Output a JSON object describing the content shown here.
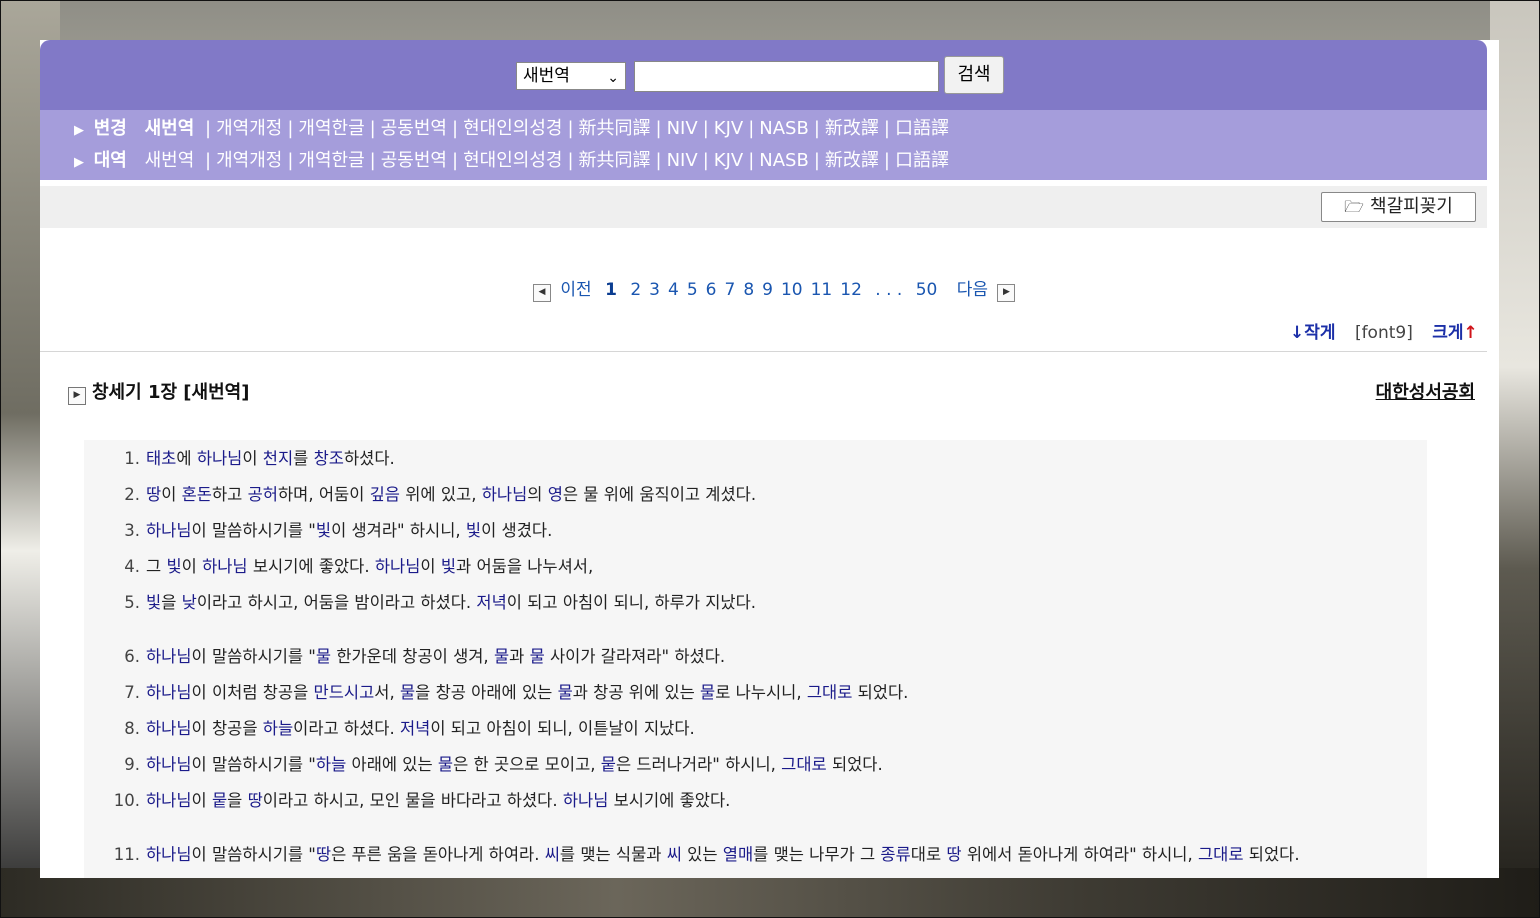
{
  "search": {
    "select_value": "새번역",
    "input_value": "",
    "button_label": "검색"
  },
  "versions": {
    "row1_label": "변경",
    "row1_selected": "새번역",
    "row2_label": "대역",
    "row2_first": "새번역",
    "options": [
      "개역개정",
      "개역한글",
      "공동번역",
      "현대인의성경",
      "新共同譯",
      "NIV",
      "KJV",
      "NASB",
      "新改譯",
      "口語譯"
    ]
  },
  "toolbar": {
    "bookmark_label": "책갈피꽂기"
  },
  "pager": {
    "prev_label": "이전",
    "current": "1",
    "pages": [
      "2",
      "3",
      "4",
      "5",
      "6",
      "7",
      "8",
      "9",
      "10",
      "11",
      "12"
    ],
    "ellipsis": ". . .",
    "last": "50",
    "next_label": "다음"
  },
  "font_control": {
    "smaller_label": "↓작게",
    "current": "[font9]",
    "larger_label": "크게",
    "larger_arrow": "↑"
  },
  "chapter": {
    "title": "창세기 1장 [새번역]",
    "publisher": "대한성서공회"
  },
  "verses": [
    {
      "num": "1.",
      "parts": [
        [
          "태초",
          "w"
        ],
        [
          "에 ",
          ""
        ],
        [
          "하나님",
          "w"
        ],
        [
          "이 ",
          ""
        ],
        [
          "천지",
          "w"
        ],
        [
          "를 ",
          ""
        ],
        [
          "창조",
          "w"
        ],
        [
          "하셨다.",
          ""
        ]
      ]
    },
    {
      "num": "2.",
      "parts": [
        [
          "땅",
          "w"
        ],
        [
          "이 ",
          ""
        ],
        [
          "혼돈",
          "w"
        ],
        [
          "하고 ",
          ""
        ],
        [
          "공허",
          "w"
        ],
        [
          "하며, 어둠이 ",
          ""
        ],
        [
          "깊음",
          "w"
        ],
        [
          " 위에 있고, ",
          ""
        ],
        [
          "하나님",
          "w"
        ],
        [
          "의 ",
          ""
        ],
        [
          "영",
          "w"
        ],
        [
          "은 물 위에 움직이고 계셨다.",
          ""
        ]
      ]
    },
    {
      "num": "3.",
      "parts": [
        [
          "하나님",
          "w"
        ],
        [
          "이 말씀하시기를 \"",
          ""
        ],
        [
          "빛",
          "w"
        ],
        [
          "이 생겨라\" 하시니, ",
          ""
        ],
        [
          "빛",
          "w"
        ],
        [
          "이 생겼다.",
          ""
        ]
      ]
    },
    {
      "num": "4.",
      "parts": [
        [
          "그 ",
          ""
        ],
        [
          "빛",
          "w"
        ],
        [
          "이 ",
          ""
        ],
        [
          "하나님",
          "w"
        ],
        [
          " 보시기에 좋았다. ",
          ""
        ],
        [
          "하나님",
          "w"
        ],
        [
          "이 ",
          ""
        ],
        [
          "빛",
          "w"
        ],
        [
          "과 어둠을 나누셔서,",
          ""
        ]
      ]
    },
    {
      "num": "5.",
      "parts": [
        [
          "빛",
          "w"
        ],
        [
          "을 ",
          ""
        ],
        [
          "낮",
          "w"
        ],
        [
          "이라고 하시고, 어둠을 밤이라고 하셨다. ",
          ""
        ],
        [
          "저녁",
          "w"
        ],
        [
          "이 되고 아침이 되니, 하루가 지났다.",
          ""
        ]
      ]
    },
    {
      "num": "6.",
      "parts": [
        [
          "하나님",
          "w"
        ],
        [
          "이 말씀하시기를 \"",
          ""
        ],
        [
          "물",
          "w"
        ],
        [
          " 한가운데 창공이 생겨, ",
          ""
        ],
        [
          "물",
          "w"
        ],
        [
          "과 ",
          ""
        ],
        [
          "물",
          "w"
        ],
        [
          " 사이가 갈라져라\" 하셨다.",
          ""
        ]
      ]
    },
    {
      "num": "7.",
      "parts": [
        [
          "하나님",
          "w"
        ],
        [
          "이 이처럼 창공을 ",
          ""
        ],
        [
          "만드시고",
          "w"
        ],
        [
          "서, ",
          ""
        ],
        [
          "물",
          "w"
        ],
        [
          "을 창공 아래에 있는 ",
          ""
        ],
        [
          "물",
          "w"
        ],
        [
          "과 창공 위에 있는 ",
          ""
        ],
        [
          "물",
          "w"
        ],
        [
          "로 나누시니, ",
          ""
        ],
        [
          "그대로",
          "w"
        ],
        [
          " 되었다.",
          ""
        ]
      ]
    },
    {
      "num": "8.",
      "parts": [
        [
          "하나님",
          "w"
        ],
        [
          "이 창공을 ",
          ""
        ],
        [
          "하늘",
          "w"
        ],
        [
          "이라고 하셨다. ",
          ""
        ],
        [
          "저녁",
          "w"
        ],
        [
          "이 되고 아침이 되니, 이튿날이 지났다.",
          ""
        ]
      ]
    },
    {
      "num": "9.",
      "parts": [
        [
          "하나님",
          "w"
        ],
        [
          "이 말씀하시기를 \"",
          ""
        ],
        [
          "하늘",
          "w"
        ],
        [
          " 아래에 있는 ",
          ""
        ],
        [
          "물",
          "w"
        ],
        [
          "은 한 곳으로 모이고, ",
          ""
        ],
        [
          "뭍",
          "w"
        ],
        [
          "은 드러나거라\" 하시니, ",
          ""
        ],
        [
          "그대로",
          "w"
        ],
        [
          " 되었다.",
          ""
        ]
      ]
    },
    {
      "num": "10.",
      "parts": [
        [
          "하나님",
          "w"
        ],
        [
          "이 ",
          ""
        ],
        [
          "뭍",
          "w"
        ],
        [
          "을 ",
          ""
        ],
        [
          "땅",
          "w"
        ],
        [
          "이라고 하시고, 모인 물을 바다라고 하셨다. ",
          ""
        ],
        [
          "하나님",
          "w"
        ],
        [
          " 보시기에 좋았다.",
          ""
        ]
      ]
    },
    {
      "num": "11.",
      "parts": [
        [
          "하나님",
          "w"
        ],
        [
          "이 말씀하시기를 \"",
          ""
        ],
        [
          "땅",
          "w"
        ],
        [
          "은 푸른 움을 돋아나게 하여라. ",
          ""
        ],
        [
          "씨",
          "w"
        ],
        [
          "를 맺는 식물과 ",
          ""
        ],
        [
          "씨",
          "w"
        ],
        [
          " 있는 ",
          ""
        ],
        [
          "열매",
          "w"
        ],
        [
          "를 맺는 나무가 그 ",
          ""
        ],
        [
          "종류",
          "w"
        ],
        [
          "대로 ",
          ""
        ],
        [
          "땅",
          "w"
        ],
        [
          " 위에서 돋아나게 하여라\" 하시니, ",
          ""
        ],
        [
          "그대로",
          "w"
        ],
        [
          " 되었다.",
          ""
        ]
      ]
    }
  ]
}
